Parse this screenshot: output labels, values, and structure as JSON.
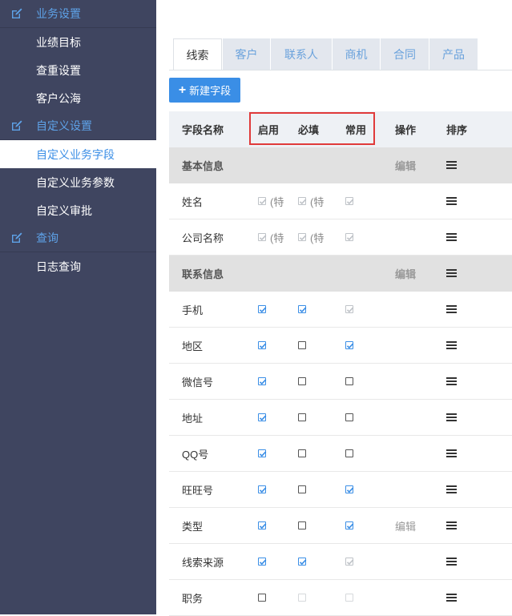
{
  "sidebar": {
    "sections": [
      {
        "label": "业务设置",
        "icon": "edit-icon",
        "items": [
          "业绩目标",
          "查重设置",
          "客户公海"
        ]
      },
      {
        "label": "自定义设置",
        "icon": "edit-icon",
        "items": [
          "自定义业务字段",
          "自定义业务参数",
          "自定义审批"
        ]
      },
      {
        "label": "查询",
        "icon": "edit-icon",
        "items": [
          "日志查询"
        ]
      }
    ],
    "active_item": "自定义业务字段"
  },
  "tabs": [
    {
      "label": "线索",
      "active": true
    },
    {
      "label": "客户",
      "active": false
    },
    {
      "label": "联系人",
      "active": false
    },
    {
      "label": "商机",
      "active": false
    },
    {
      "label": "合同",
      "active": false
    },
    {
      "label": "产品",
      "active": false
    }
  ],
  "new_field_button": "新建字段",
  "table": {
    "headers": {
      "name": "字段名称",
      "enable": "启用",
      "required": "必填",
      "common": "常用",
      "op": "操作",
      "sort": "排序"
    },
    "rows": [
      {
        "type": "group",
        "name": "基本信息",
        "op": "编辑"
      },
      {
        "type": "field",
        "name": "姓名",
        "enable": "checked-disabled",
        "enable_tag": "(特",
        "required": "checked-disabled",
        "required_tag": "(特",
        "common": "checked-disabled",
        "op": ""
      },
      {
        "type": "field",
        "name": "公司名称",
        "enable": "checked-disabled",
        "enable_tag": "(特",
        "required": "checked-disabled",
        "required_tag": "(特",
        "common": "checked-disabled",
        "op": ""
      },
      {
        "type": "group",
        "name": "联系信息",
        "op": "编辑"
      },
      {
        "type": "field",
        "name": "手机",
        "enable": "checked",
        "required": "checked",
        "common": "checked-disabled",
        "op": ""
      },
      {
        "type": "field",
        "name": "地区",
        "enable": "checked",
        "required": "unchecked",
        "common": "checked",
        "op": ""
      },
      {
        "type": "field",
        "name": "微信号",
        "enable": "checked",
        "required": "unchecked",
        "common": "unchecked",
        "op": ""
      },
      {
        "type": "field",
        "name": "地址",
        "enable": "checked",
        "required": "unchecked",
        "common": "unchecked",
        "op": ""
      },
      {
        "type": "field",
        "name": "QQ号",
        "enable": "checked",
        "required": "unchecked",
        "common": "unchecked",
        "op": ""
      },
      {
        "type": "field",
        "name": "旺旺号",
        "enable": "checked",
        "required": "unchecked",
        "common": "checked",
        "op": ""
      },
      {
        "type": "field",
        "name": "类型",
        "enable": "checked",
        "required": "unchecked",
        "common": "checked",
        "op": "编辑"
      },
      {
        "type": "field",
        "name": "线索来源",
        "enable": "checked",
        "required": "checked",
        "common": "checked-disabled",
        "op": ""
      },
      {
        "type": "field",
        "name": "职务",
        "enable": "unchecked",
        "required": "unchecked-disabled",
        "common": "unchecked-disabled",
        "op": ""
      }
    ]
  },
  "colors": {
    "accent": "#3a8ee6",
    "sidebar_bg": "#3f4560",
    "highlight": "#e03a3a"
  }
}
